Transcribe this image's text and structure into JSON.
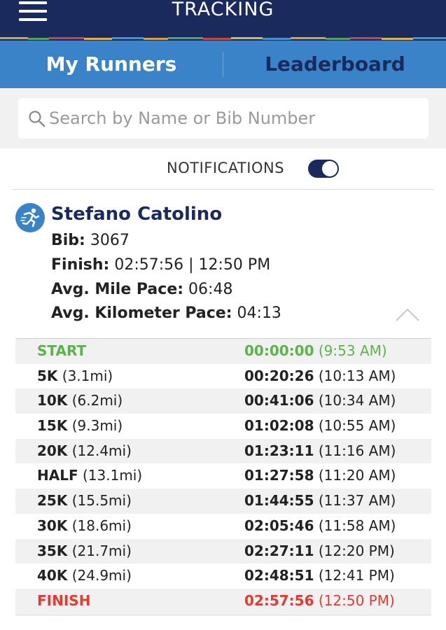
{
  "header": {
    "title": "TRACKING",
    "menu_icon": "hamburger-icon"
  },
  "tabs": [
    {
      "label": "My Runners",
      "active": true
    },
    {
      "label": "Leaderboard",
      "active": false
    }
  ],
  "search": {
    "placeholder": "Search by Name or Bib Number",
    "value": "",
    "icon": "search-icon"
  },
  "notifications": {
    "label": "NOTIFICATIONS",
    "enabled": true
  },
  "runner": {
    "name": "Stefano Catolino",
    "icon": "runner-icon",
    "bib_label": "Bib:",
    "bib": "3067",
    "finish_label": "Finish:",
    "finish": "02:57:56 | 12:50 PM",
    "mile_pace_label": "Avg. Mile Pace:",
    "mile_pace": "06:48",
    "km_pace_label": "Avg. Kilometer Pace:",
    "km_pace": "04:13"
  },
  "splits": [
    {
      "label": "START",
      "distance": "",
      "time": "00:00:00",
      "clock": "(9:53 AM)",
      "status": "start"
    },
    {
      "label": "5K",
      "distance": "(3.1mi)",
      "time": "00:20:26",
      "clock": "(10:13 AM)",
      "status": "normal"
    },
    {
      "label": "10K",
      "distance": "(6.2mi)",
      "time": "00:41:06",
      "clock": "(10:34 AM)",
      "status": "normal"
    },
    {
      "label": "15K",
      "distance": "(9.3mi)",
      "time": "01:02:08",
      "clock": "(10:55 AM)",
      "status": "normal"
    },
    {
      "label": "20K",
      "distance": "(12.4mi)",
      "time": "01:23:11",
      "clock": "(11:16 AM)",
      "status": "normal"
    },
    {
      "label": "HALF",
      "distance": "(13.1mi)",
      "time": "01:27:58",
      "clock": "(11:20 AM)",
      "status": "normal"
    },
    {
      "label": "25K",
      "distance": "(15.5mi)",
      "time": "01:44:55",
      "clock": "(11:37 AM)",
      "status": "normal"
    },
    {
      "label": "30K",
      "distance": "(18.6mi)",
      "time": "02:05:46",
      "clock": "(11:58 AM)",
      "status": "normal"
    },
    {
      "label": "35K",
      "distance": "(21.7mi)",
      "time": "02:27:11",
      "clock": "(12:20 PM)",
      "status": "normal"
    },
    {
      "label": "40K",
      "distance": "(24.9mi)",
      "time": "02:48:51",
      "clock": "(12:41 PM)",
      "status": "normal"
    },
    {
      "label": "FINISH",
      "distance": "",
      "time": "02:57:56",
      "clock": "(12:50 PM)",
      "status": "finish"
    }
  ],
  "colors": {
    "header_bg": "#1b2a5c",
    "tab_bar_bg": "#3a83c9",
    "start_green": "#5bb34a",
    "finish_red": "#e03c31"
  }
}
